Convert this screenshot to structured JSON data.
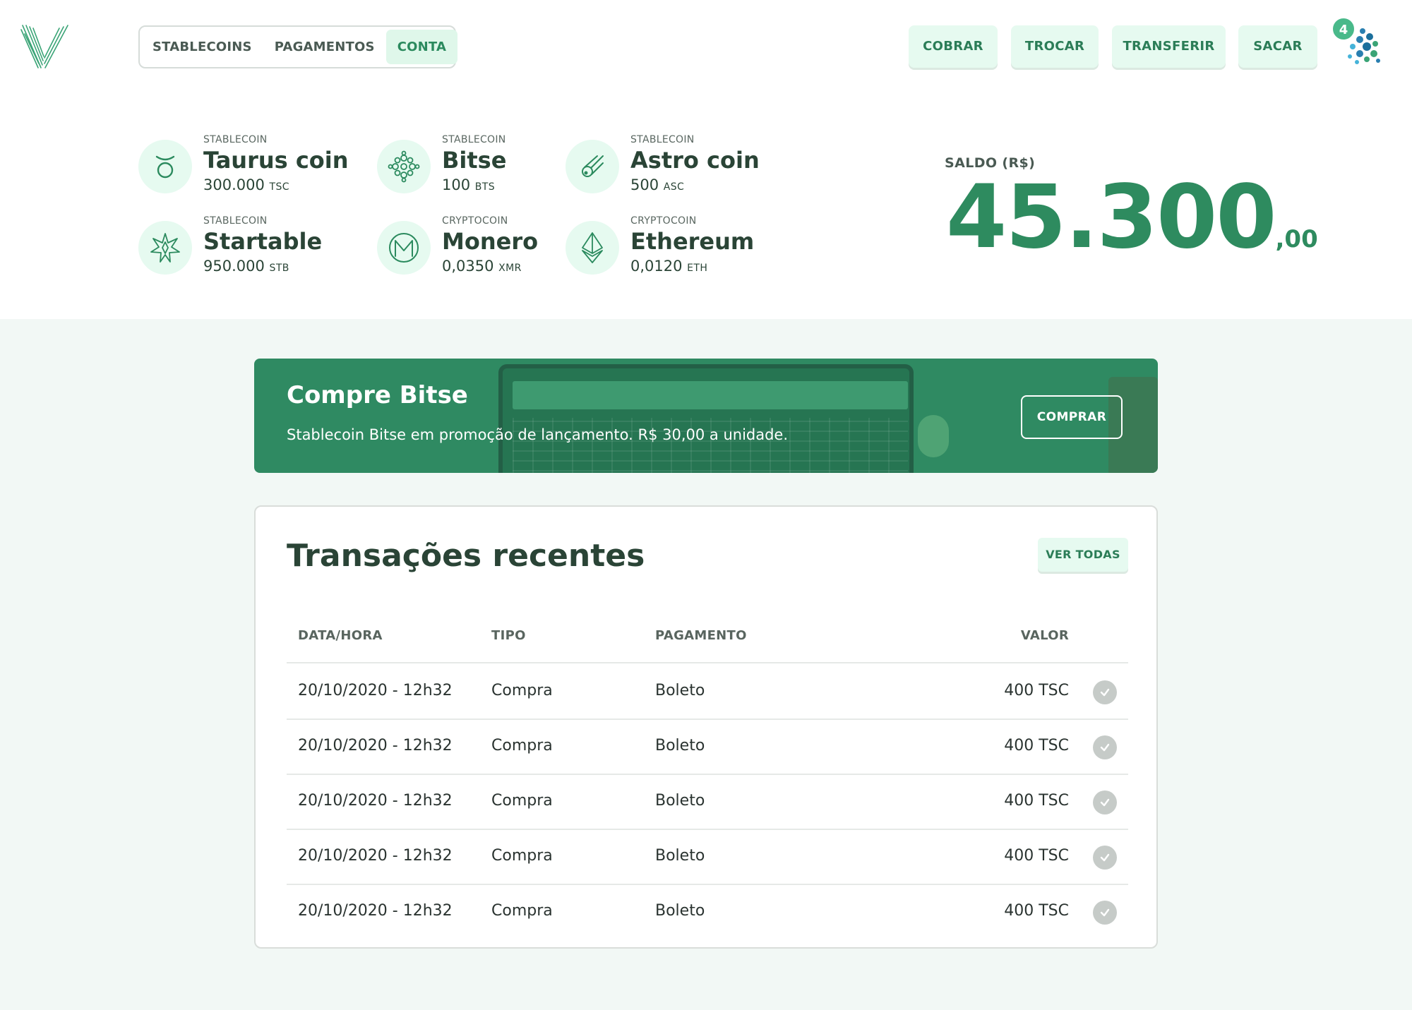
{
  "nav": {
    "tabs": [
      {
        "label": "STABLECOINS",
        "active": false
      },
      {
        "label": "PAGAMENTOS",
        "active": false
      },
      {
        "label": "CONTA",
        "active": true
      }
    ]
  },
  "actions": {
    "cobrar": "COBRAR",
    "trocar": "TROCAR",
    "transferir": "TRANSFERIR",
    "sacar": "SACAR"
  },
  "user": {
    "notification_count": "4"
  },
  "coins": [
    {
      "category": "STABLECOIN",
      "name": "Taurus coin",
      "amount": "300.000",
      "unit": "TSC",
      "icon": "taurus-icon"
    },
    {
      "category": "STABLECOIN",
      "name": "Bitse",
      "amount": "100",
      "unit": "BTS",
      "icon": "bitse-icon"
    },
    {
      "category": "STABLECOIN",
      "name": "Astro coin",
      "amount": "500",
      "unit": "ASC",
      "icon": "comet-icon"
    },
    {
      "category": "STABLECOIN",
      "name": "Startable",
      "amount": "950.000",
      "unit": "STB",
      "icon": "star-icon"
    },
    {
      "category": "CRYPTOCOIN",
      "name": "Monero",
      "amount": "0,0350",
      "unit": "XMR",
      "icon": "monero-icon"
    },
    {
      "category": "CRYPTOCOIN",
      "name": "Ethereum",
      "amount": "0,0120",
      "unit": "ETH",
      "icon": "ethereum-icon"
    }
  ],
  "balance": {
    "label": "SALDO (R$)",
    "integer": "45.300",
    "decimal": ",00"
  },
  "banner": {
    "title": "Compre Bitse",
    "subtitle": "Stablecoin Bitse em promoção de lançamento. R$ 30,00 a unidade.",
    "cta": "COMPRAR"
  },
  "transactions": {
    "title": "Transações recentes",
    "view_all": "VER TODAS",
    "columns": {
      "date": "DATA/HORA",
      "type": "TIPO",
      "payment": "PAGAMENTO",
      "value": "VALOR"
    },
    "rows": [
      {
        "date": "20/10/2020 - 12h32",
        "type": "Compra",
        "payment": "Boleto",
        "value": "400 TSC"
      },
      {
        "date": "20/10/2020 - 12h32",
        "type": "Compra",
        "payment": "Boleto",
        "value": "400 TSC"
      },
      {
        "date": "20/10/2020 - 12h32",
        "type": "Compra",
        "payment": "Boleto",
        "value": "400 TSC"
      },
      {
        "date": "20/10/2020 - 12h32",
        "type": "Compra",
        "payment": "Boleto",
        "value": "400 TSC"
      },
      {
        "date": "20/10/2020 - 12h32",
        "type": "Compra",
        "payment": "Boleto",
        "value": "400 TSC"
      }
    ]
  },
  "colors": {
    "accent": "#2e8b5f",
    "accent_light": "#e6faf0",
    "background": "#f2f8f5"
  }
}
